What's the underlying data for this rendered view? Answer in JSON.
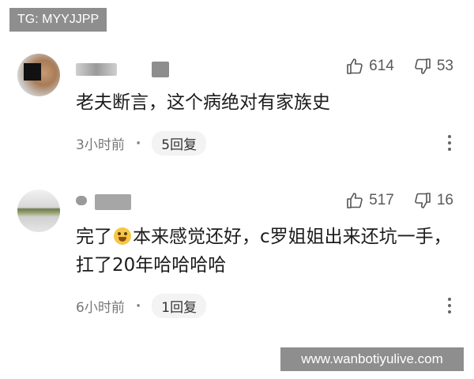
{
  "watermark_top": "TG: MYYJJPP",
  "watermark_bottom": "www.wanbotiyulive.com",
  "colors": {
    "watermark_bg": "#8e8e8e",
    "text": "#1c1c1c",
    "meta": "#777777"
  },
  "comments": [
    {
      "text": "老夫断言，这个病绝对有家族史",
      "likes": "614",
      "dislikes": "53",
      "time": "3小时前",
      "separator": "·",
      "replies": "5回复"
    },
    {
      "text_before_emoji": "完了",
      "emoji": "laughing-crying-face-icon",
      "text_after_emoji": "本来感觉还好，c罗姐姐出来还坑一手，扛了20年哈哈哈哈",
      "likes": "517",
      "dislikes": "16",
      "time": "6小时前",
      "separator": "·",
      "replies": "1回复"
    }
  ]
}
